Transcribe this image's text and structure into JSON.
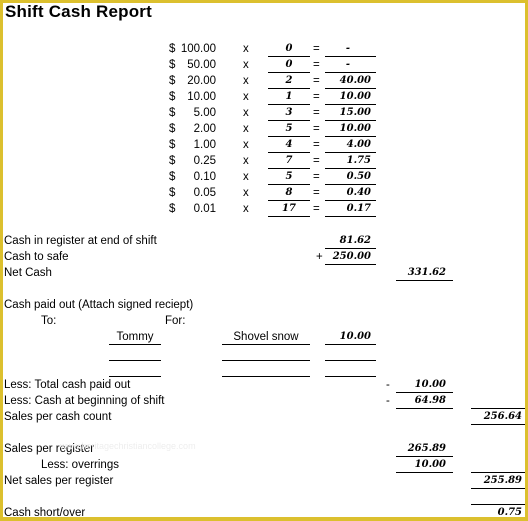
{
  "title": "Shift Cash Report",
  "denominations": [
    {
      "currency": "$",
      "value": "100.00",
      "times": "x",
      "count": "0",
      "equals": "=",
      "total": "-"
    },
    {
      "currency": "$",
      "value": "50.00",
      "times": "x",
      "count": "0",
      "equals": "=",
      "total": "-"
    },
    {
      "currency": "$",
      "value": "20.00",
      "times": "x",
      "count": "2",
      "equals": "=",
      "total": "40.00"
    },
    {
      "currency": "$",
      "value": "10.00",
      "times": "x",
      "count": "1",
      "equals": "=",
      "total": "10.00"
    },
    {
      "currency": "$",
      "value": "5.00",
      "times": "x",
      "count": "3",
      "equals": "=",
      "total": "15.00"
    },
    {
      "currency": "$",
      "value": "2.00",
      "times": "x",
      "count": "5",
      "equals": "=",
      "total": "10.00"
    },
    {
      "currency": "$",
      "value": "1.00",
      "times": "x",
      "count": "4",
      "equals": "=",
      "total": "4.00"
    },
    {
      "currency": "$",
      "value": "0.25",
      "times": "x",
      "count": "7",
      "equals": "=",
      "total": "1.75"
    },
    {
      "currency": "$",
      "value": "0.10",
      "times": "x",
      "count": "5",
      "equals": "=",
      "total": "0.50"
    },
    {
      "currency": "$",
      "value": "0.05",
      "times": "x",
      "count": "8",
      "equals": "=",
      "total": "0.40"
    },
    {
      "currency": "$",
      "value": "0.01",
      "times": "x",
      "count": "17",
      "equals": "=",
      "total": "0.17"
    }
  ],
  "cash_section": {
    "cash_in_register_label": "Cash in register at end of shift",
    "cash_in_register_value": "81.62",
    "cash_to_safe_label": "Cash to safe",
    "cash_to_safe_sign": "+",
    "cash_to_safe_value": "250.00",
    "net_cash_label": "Net Cash",
    "net_cash_value": "331.62"
  },
  "paid_out": {
    "heading": "Cash paid out  (Attach signed reciept)",
    "to_label": "To:",
    "for_label": "For:",
    "entries": [
      {
        "to": "Tommy",
        "for": "Shovel snow",
        "amount": "10.00"
      },
      {
        "to": "",
        "for": "",
        "amount": ""
      },
      {
        "to": "",
        "for": "",
        "amount": ""
      }
    ]
  },
  "summary": {
    "total_paid_out_label": "Less:  Total cash paid out",
    "total_paid_out_sign": "-",
    "total_paid_out_value": "10.00",
    "cash_beginning_label": "Less:  Cash at beginning of shift",
    "cash_beginning_sign": "-",
    "cash_beginning_value": "64.98",
    "sales_cash_count_label": "Sales per cash count",
    "sales_cash_count_value": "256.64",
    "sales_register_label": "Sales per register",
    "sales_register_value": "265.89",
    "overrings_label": "Less:  overrings",
    "overrings_value": "10.00",
    "net_sales_label": "Net sales per register",
    "net_sales_value": "255.89",
    "short_over_label": "Cash short/over",
    "short_over_value": "0.75"
  },
  "watermark": "www.heritagechristiancollege.com"
}
